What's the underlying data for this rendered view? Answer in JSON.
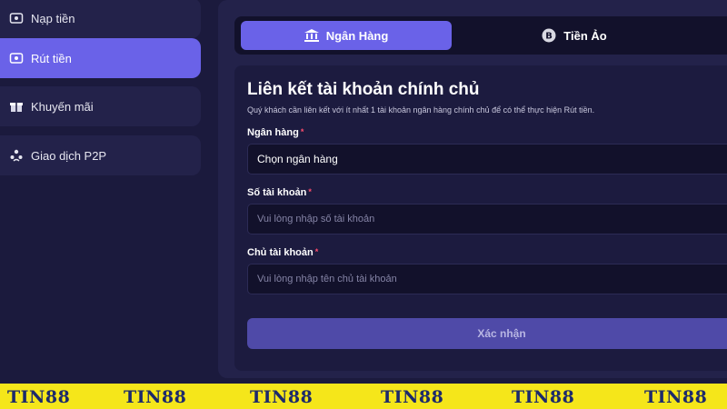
{
  "sidebar": {
    "items": [
      {
        "label": "Nạp tiền",
        "icon": "deposit-icon"
      },
      {
        "label": "Rút tiền",
        "icon": "withdraw-icon",
        "active": true
      },
      {
        "label": "Khuyến mãi",
        "icon": "gift-icon"
      },
      {
        "label": "Giao dịch P2P",
        "icon": "p2p-icon"
      }
    ]
  },
  "tabs": [
    {
      "label": "Ngân Hàng",
      "icon": "bank-icon",
      "active": true
    },
    {
      "label": "Tiền Ảo",
      "icon": "bitcoin-icon",
      "active": false
    }
  ],
  "form": {
    "title": "Liên kết tài khoản chính chủ",
    "subtitle": "Quý khách cần liên kết với ít nhất 1 tài khoản ngân hàng chính chủ để có thể thực hiện Rút tiền.",
    "bank": {
      "label": "Ngân hàng",
      "value": "Chọn ngân hàng"
    },
    "account_number": {
      "label": "Số tài khoản",
      "placeholder": "Vui lòng nhập số tài khoản"
    },
    "account_holder": {
      "label": "Chủ tài khoản",
      "placeholder": "Vui lòng nhập tên chủ tài khoản"
    },
    "required_mark": "*",
    "submit_label": "Xác nhận"
  },
  "watermark": {
    "text": "TIN88",
    "copies": [
      "TIN88",
      "TIN88",
      "TIN88",
      "TIN88",
      "TIN88",
      "TIN88"
    ]
  },
  "colors": {
    "background": "#1b1a3d",
    "accent": "#6a62e8",
    "panel": "#23224a",
    "field": "#12112b",
    "required": "#ff4d6d",
    "band": "#f5e61a",
    "band_text": "#1d2a6b"
  }
}
